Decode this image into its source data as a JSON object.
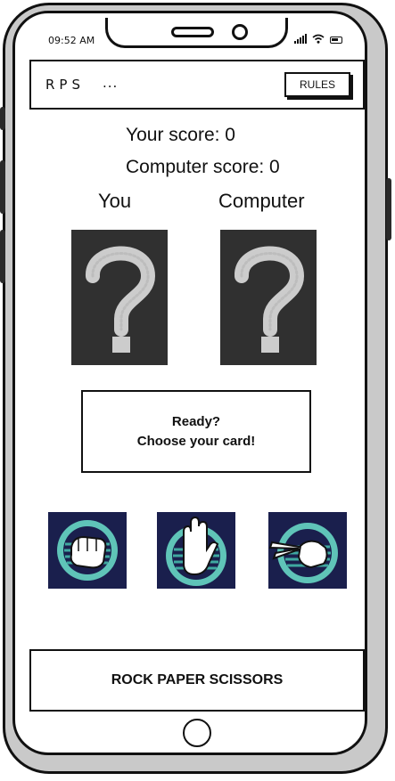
{
  "status_bar": {
    "time": "09:52 AM"
  },
  "header": {
    "logo": "RPS",
    "menu": "...",
    "rules_button": "RULES"
  },
  "scores": {
    "player": "Your score: 0",
    "computer": "Computer score: 0"
  },
  "labels": {
    "player": "You",
    "computer": "Computer"
  },
  "cards": {
    "player": "?",
    "computer": "?"
  },
  "result": {
    "line1": "Ready?",
    "line2": "Choose your card!"
  },
  "choices": [
    {
      "name": "rock",
      "icon": "rock-hand-icon"
    },
    {
      "name": "paper",
      "icon": "paper-hand-icon"
    },
    {
      "name": "scissors",
      "icon": "scissors-hand-icon"
    }
  ],
  "footer": {
    "title": "ROCK PAPER SCISSORS"
  },
  "colors": {
    "card_bg": "#1a1f4d",
    "ring": "#5fc4b8",
    "chalkboard": "#2b2b2b",
    "phone_frame": "#c9c9c9"
  }
}
